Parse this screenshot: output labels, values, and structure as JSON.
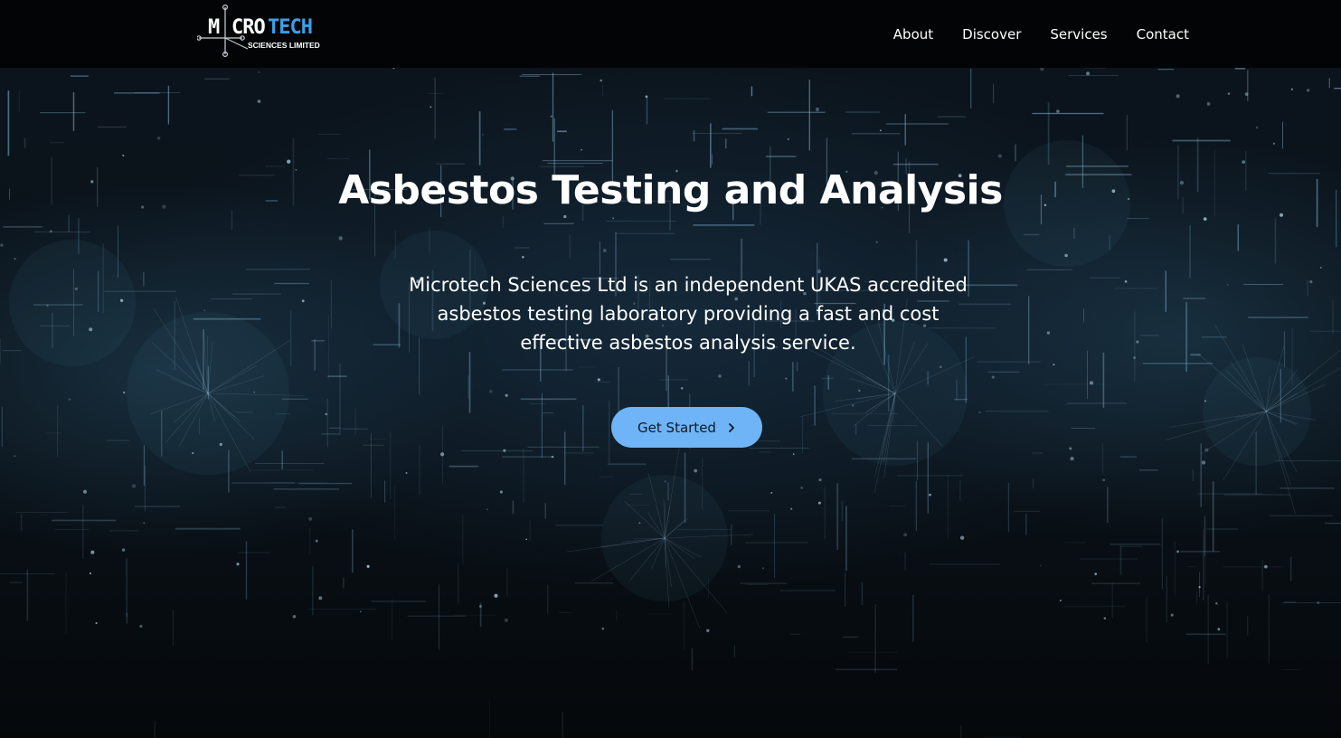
{
  "header": {
    "logo": {
      "word_part1": "M",
      "word_part2": "CRO",
      "word_part3": "TECH",
      "subtitle": "SCIENCES LIMITED"
    },
    "nav": [
      {
        "label": "About"
      },
      {
        "label": "Discover"
      },
      {
        "label": "Services"
      },
      {
        "label": "Contact"
      }
    ]
  },
  "hero": {
    "title": "Asbestos Testing and Analysis",
    "description": "Microtech Sciences Ltd is an independent UKAS accredited asbestos testing laboratory providing a fast and cost effective asbestos analysis service.",
    "cta_label": "Get Started"
  },
  "colors": {
    "accent": "#6fb4f6",
    "header_bg": "#030405",
    "logo_blue": "#3aa0e8"
  },
  "icons": {
    "cta": "chevron-right-icon"
  }
}
